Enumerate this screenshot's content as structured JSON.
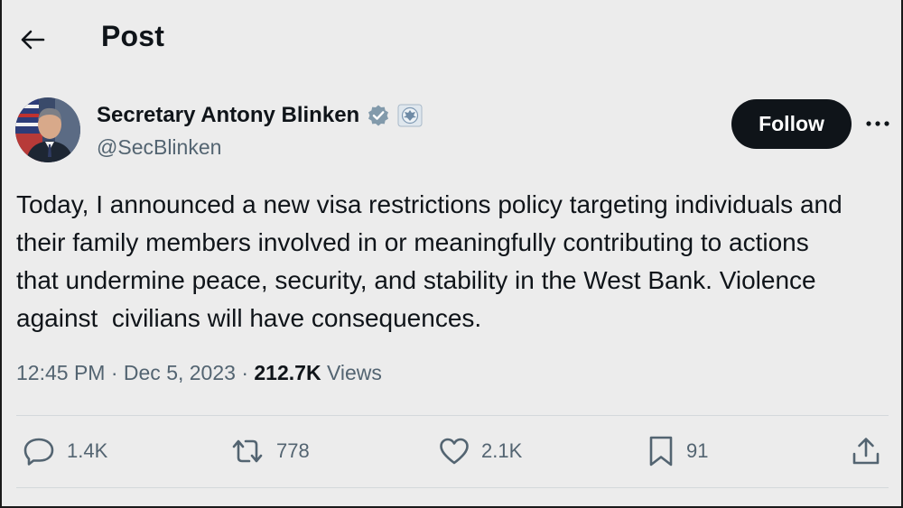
{
  "header": {
    "title": "Post"
  },
  "author": {
    "name": "Secretary Antony Blinken",
    "handle": "@SecBlinken"
  },
  "follow_label": "Follow",
  "tweet": {
    "text": "Today, I announced a new visa restrictions policy targeting individuals and\ntheir family members involved in or meaningfully contributing to actions\nthat undermine peace, security, and stability in the West Bank. Violence\nagainst  civilians will have consequences."
  },
  "meta": {
    "time": "12:45 PM",
    "date": "Dec 5, 2023",
    "views_count": "212.7K",
    "views_label": "Views",
    "separator": "·"
  },
  "actions": {
    "replies": "1.4K",
    "reposts": "778",
    "likes": "2.1K",
    "bookmarks": "91"
  },
  "colors": {
    "background": "#ececec",
    "text": "#0f1419",
    "secondary": "#536471",
    "verified_badge": "#829aab"
  },
  "icons": {
    "back": "arrow-left-icon",
    "verified": "verified-badge-icon",
    "affiliation": "state-department-seal-icon",
    "more": "more-horizontal-icon",
    "reply": "reply-icon",
    "repost": "repost-icon",
    "like": "heart-icon",
    "bookmark": "bookmark-icon",
    "share": "share-icon"
  }
}
